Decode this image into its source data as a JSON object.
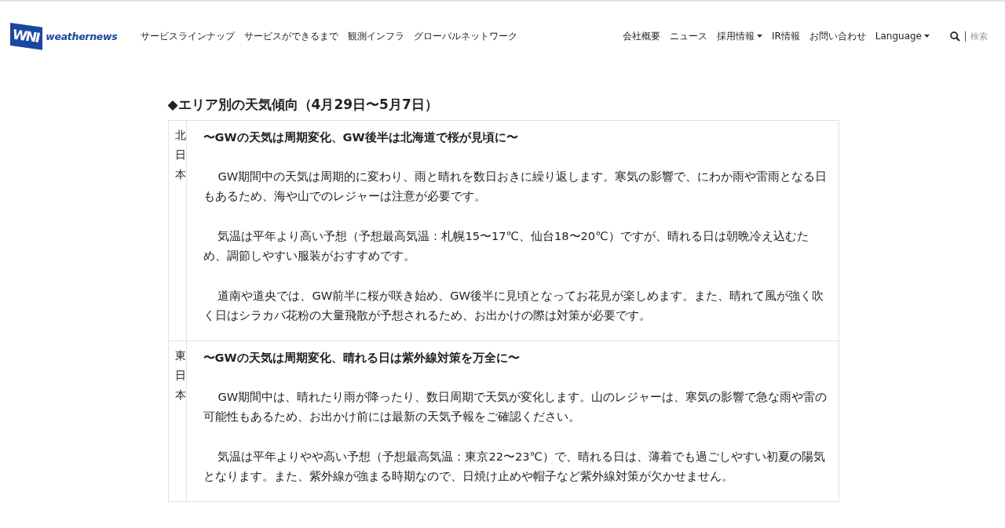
{
  "header": {
    "logo": {
      "mark": "WNI",
      "name": "weathernews"
    },
    "main_nav": [
      "サービスラインナップ",
      "サービスができるまで",
      "観測インフラ",
      "グローバルネットワーク"
    ],
    "utility_nav": [
      {
        "label": "会社概要",
        "dropdown": false
      },
      {
        "label": "ニュース",
        "dropdown": false
      },
      {
        "label": "採用情報",
        "dropdown": true
      },
      {
        "label": "IR情報",
        "dropdown": false
      },
      {
        "label": "お問い合わせ",
        "dropdown": false
      },
      {
        "label": "Language",
        "dropdown": true
      }
    ],
    "search": {
      "placeholder": "検索"
    }
  },
  "section": {
    "title": "◆エリア別の天気傾向（4月29日〜5月7日）",
    "rows": [
      {
        "area": "北日本",
        "headline": "〜GWの天気は周期変化、GW後半は北海道で桜が見頃に〜",
        "paragraphs": [
          "GW期間中の天気は周期的に変わり、雨と晴れを数日おきに繰り返します。寒気の影響で、にわか雨や雷雨となる日もあるため、海や山でのレジャーは注意が必要です。",
          "気温は平年より高い予想（予想最高気温：札幌15〜17℃、仙台18〜20℃）ですが、晴れる日は朝晩冷え込むため、調節しやすい服装がおすすめです。",
          "道南や道央では、GW前半に桜が咲き始め、GW後半に見頃となってお花見が楽しめます。また、晴れて風が強く吹く日はシラカバ花粉の大量飛散が予想されるため、お出かけの際は対策が必要です。"
        ]
      },
      {
        "area": "東日本",
        "headline": "〜GWの天気は周期変化、晴れる日は紫外線対策を万全に〜",
        "paragraphs": [
          "GW期間中は、晴れたり雨が降ったり、数日周期で天気が変化します。山のレジャーは、寒気の影響で急な雨や雷の可能性もあるため、お出かけ前には最新の天気予報をご確認ください。",
          "気温は平年よりやや高い予想（予想最高気温：東京22〜23℃）で、晴れる日は、薄着でも過ごしやすい初夏の陽気となります。また、紫外線が強まる時期なので、日焼け止めや帽子など紫外線対策が欠かせません。"
        ]
      }
    ]
  }
}
